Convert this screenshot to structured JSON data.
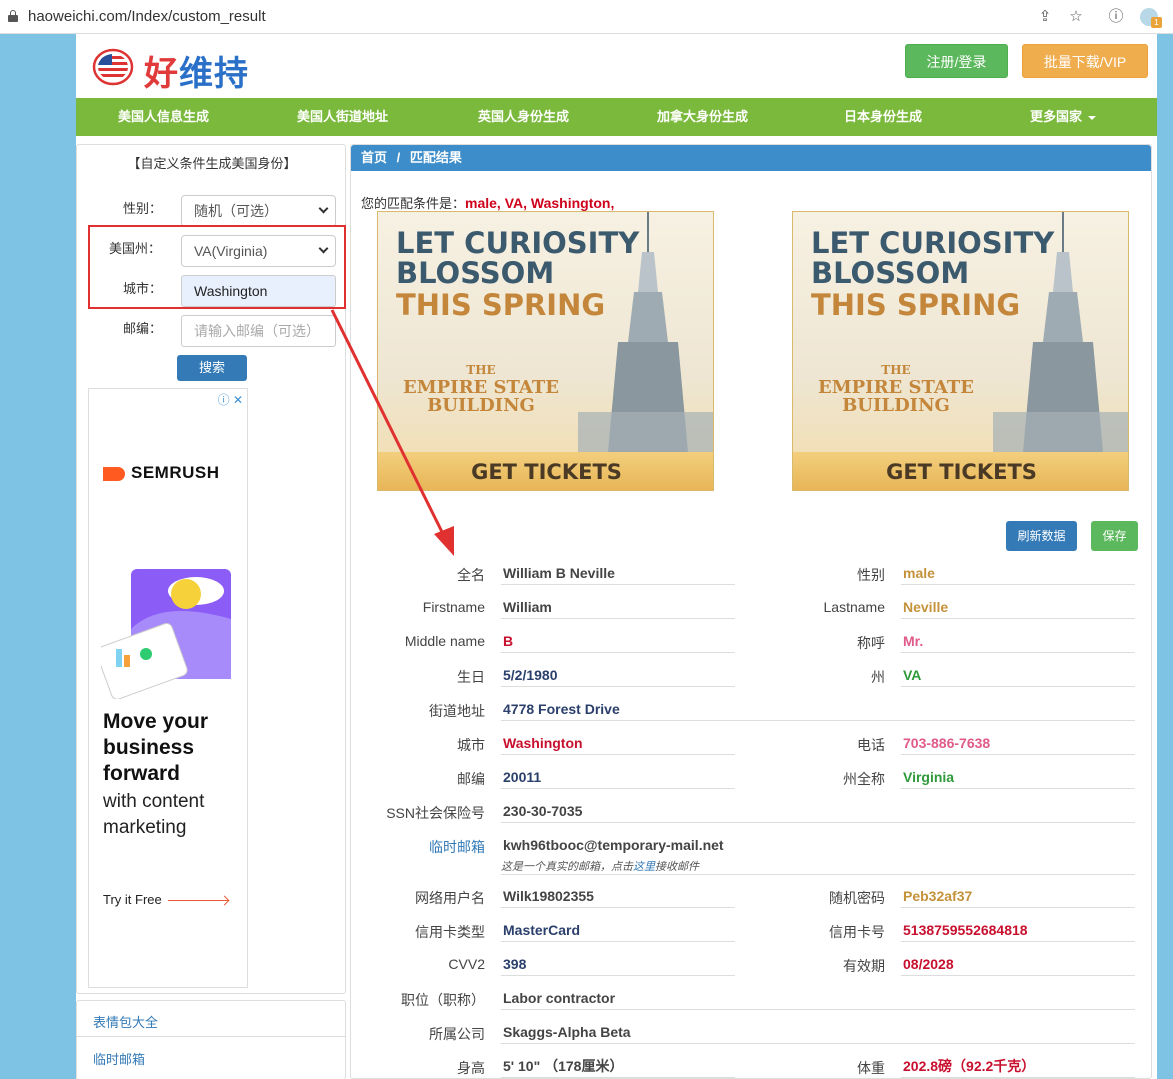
{
  "browser": {
    "url": "haoweichi.com/Index/custom_result",
    "ext_badge": "1"
  },
  "header": {
    "logo_a": "好",
    "logo_b": "维持",
    "login_label": "注册/登录",
    "vip_label": "批量下载/VIP"
  },
  "nav": [
    {
      "label": "美国人信息生成"
    },
    {
      "label": "美国人街道地址"
    },
    {
      "label": "英国人身份生成"
    },
    {
      "label": "加拿大身份生成"
    },
    {
      "label": "日本身份生成"
    },
    {
      "label": "更多国家"
    }
  ],
  "sidebar": {
    "title": "【自定义条件生成美国身份】",
    "gender_label": "性别：",
    "gender_value": "随机（可选）",
    "state_label": "美国州：",
    "state_value": "VA(Virginia)",
    "city_label": "城市：",
    "city_value": "Washington",
    "zip_label": "邮编：",
    "zip_placeholder": "请输入邮编（可选）",
    "search_label": "搜索",
    "ad": {
      "brand": "SEMRUSH",
      "headline": "Move your business forward",
      "sub": "with content marketing",
      "cta": "Try it Free"
    },
    "links": [
      {
        "label": "表情包大全"
      },
      {
        "label": "临时邮箱"
      }
    ]
  },
  "main": {
    "breadcrumb_home": "首页",
    "breadcrumb_sep": "/",
    "breadcrumb_current": "匹配结果",
    "cond_prefix": "您的匹配条件是：",
    "cond_value": "male, VA, Washington,",
    "banner": {
      "line1": "LET CURIOSITY",
      "line1b": "BLOSSOM",
      "line2": "THIS SPRING",
      "esb_1": "THE",
      "esb_2": "EMPIRE STATE",
      "esb_3": "BUILDING",
      "cta": "GET TICKETS"
    },
    "refresh_label": "刷新数据",
    "save_label": "保存",
    "fields": {
      "fullname_label": "全名",
      "fullname": "William B Neville",
      "gender_label": "性别",
      "gender": "male",
      "firstname_label": "Firstname",
      "firstname": "William",
      "lastname_label": "Lastname",
      "lastname": "Neville",
      "middlename_label": "Middle name",
      "middlename": "B",
      "title_label": "称呼",
      "title": "Mr.",
      "birthday_label": "生日",
      "birthday": "5/2/1980",
      "state_label": "州",
      "state": "VA",
      "street_label": "街道地址",
      "street": "4778 Forest Drive",
      "city_label": "城市",
      "city": "Washington",
      "phone_label": "电话",
      "phone": "703-886-7638",
      "zip_label": "邮编",
      "zip": "20011",
      "state_full_label": "州全称",
      "state_full": "Virginia",
      "ssn_label": "SSN社会保险号",
      "ssn": "230-30-7035",
      "email_label": "临时邮箱",
      "email": "kwh96tbooc@temporary-mail.net",
      "email_note_a": "这是一个真实的邮箱，点击",
      "email_note_link": "这里",
      "email_note_b": "接收邮件",
      "username_label": "网络用户名",
      "username": "Wilk19802355",
      "password_label": "随机密码",
      "password": "Peb32af37",
      "cardtype_label": "信用卡类型",
      "cardtype": "MasterCard",
      "cardnum_label": "信用卡号",
      "cardnum": "5138759552684818",
      "cvv_label": "CVV2",
      "cvv": "398",
      "expiry_label": "有效期",
      "expiry": "08/2028",
      "job_label": "职位（职称）",
      "job": "Labor contractor",
      "company_label": "所属公司",
      "company": "Skaggs-Alpha Beta",
      "height_label": "身高",
      "height": "5' 10\"  （178厘米）",
      "weight_label": "体重",
      "weight": "202.8磅（92.2千克）"
    }
  },
  "colors": {
    "nav": "#7ab93b",
    "panel_head": "#3c8dc9",
    "annotation": "#e03030"
  }
}
